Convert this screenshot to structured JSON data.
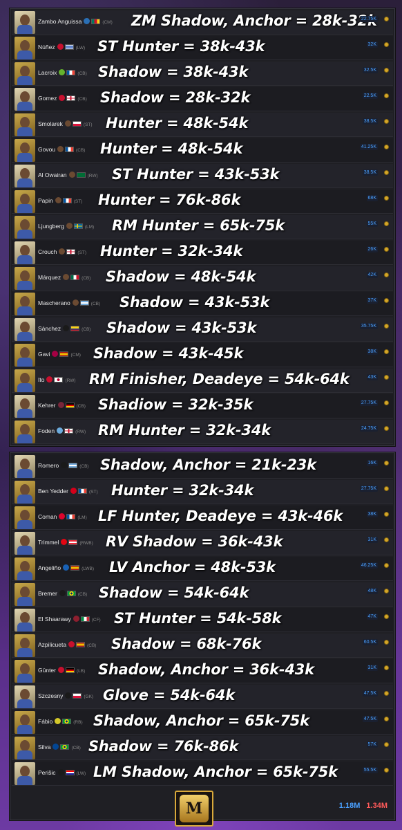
{
  "panel1": [
    {
      "name": "Zambo Anguissa",
      "pos": "(CM)",
      "price": "22.75K",
      "note": "ZM Shadow, Anchor = 28k-32k",
      "club_color": "#2a6fb5",
      "flag": "cameroon"
    },
    {
      "name": "Núñez",
      "pos": "(LW)",
      "price": "32K",
      "note": "ST Hunter = 38k-43k",
      "club_color": "#c8102e",
      "flag": "uruguay"
    },
    {
      "name": "Lacroix",
      "pos": "(CB)",
      "price": "32.5K",
      "note": "Shadow = 38k-43k",
      "club_color": "#65b32e",
      "flag": "france"
    },
    {
      "name": "Gomez",
      "pos": "(CB)",
      "price": "22.5K",
      "note": "Shadow = 28k-32k",
      "club_color": "#c8102e",
      "flag": "england"
    },
    {
      "name": "Smolarek",
      "pos": "(ST)",
      "price": "38.5K",
      "note": "Hunter = 48k-54k",
      "club_color": "#6b4a32",
      "flag": "poland"
    },
    {
      "name": "Govou",
      "pos": "(CB)",
      "price": "41.25K",
      "note": "Hunter = 48k-54k",
      "club_color": "#6b4a32",
      "flag": "france"
    },
    {
      "name": "Al Owairan",
      "pos": "(RW)",
      "price": "38.5K",
      "note": "ST Hunter = 43k-53k",
      "club_color": "#6b4a32",
      "flag": "saudi"
    },
    {
      "name": "Papin",
      "pos": "(ST)",
      "price": "68K",
      "note": "Hunter = 76k-86k",
      "club_color": "#6b4a32",
      "flag": "france"
    },
    {
      "name": "Ljungberg",
      "pos": "(LM)",
      "price": "55K",
      "note": "RM Hunter = 65k-75k",
      "club_color": "#6b4a32",
      "flag": "sweden"
    },
    {
      "name": "Crouch",
      "pos": "(ST)",
      "price": "26K",
      "note": "Hunter = 32k-34k",
      "club_color": "#6b4a32",
      "flag": "england"
    },
    {
      "name": "Márquez",
      "pos": "(CB)",
      "price": "42K",
      "note": "Shadow = 48k-54k",
      "club_color": "#6b4a32",
      "flag": "mexico"
    },
    {
      "name": "Mascherano",
      "pos": "(CB)",
      "price": "37K",
      "note": "Shadow = 43k-53k",
      "club_color": "#6b4a32",
      "flag": "argentina"
    },
    {
      "name": "Sánchez",
      "pos": "(CB)",
      "price": "35.75K",
      "note": "Shadow = 43k-53k",
      "club_color": "#1a1a1a",
      "flag": "colombia"
    },
    {
      "name": "Gavi",
      "pos": "(CM)",
      "price": "38K",
      "note": "Shadow = 43k-45k",
      "club_color": "#a50044",
      "flag": "spain"
    },
    {
      "name": "Ito",
      "pos": "(RW)",
      "price": "43K",
      "note": "RM Finisher, Deadeye = 54k-64k",
      "club_color": "#c8102e",
      "flag": "japan"
    },
    {
      "name": "Kehrer",
      "pos": "(CB)",
      "price": "27.75K",
      "note": "Shadiow = 32k-35k",
      "club_color": "#7a263a",
      "flag": "germany"
    },
    {
      "name": "Foden",
      "pos": "(RW)",
      "price": "24.75K",
      "note": "RM Hunter = 32k-34k",
      "club_color": "#6cabdd",
      "flag": "england"
    }
  ],
  "panel2": [
    {
      "name": "Romero",
      "pos": "(CB)",
      "price": "16K",
      "note": "Shadow, Anchor = 21k-23k",
      "club_color": "#1a1a1a",
      "flag": "argentina"
    },
    {
      "name": "Ben Yedder",
      "pos": "(ST)",
      "price": "27.75K",
      "note": "Hunter = 32k-34k",
      "club_color": "#d4001a",
      "flag": "france"
    },
    {
      "name": "Coman",
      "pos": "(LM)",
      "price": "38K",
      "note": "LF Hunter, Deadeye = 43k-46k",
      "club_color": "#dc052d",
      "flag": "france"
    },
    {
      "name": "Trimmel",
      "pos": "(RWB)",
      "price": "31K",
      "note": "RV Shadow = 36k-43k",
      "club_color": "#e30613",
      "flag": "austria"
    },
    {
      "name": "Angeliño",
      "pos": "(LWB)",
      "price": "46.25K",
      "note": "LV Anchor = 48k-53k",
      "club_color": "#1961b5",
      "flag": "spain"
    },
    {
      "name": "Bremer",
      "pos": "(CB)",
      "price": "48K",
      "note": "Shadow = 54k-64k",
      "club_color": "#1a1a1a",
      "flag": "brazil"
    },
    {
      "name": "El Shaarawy",
      "pos": "(CF)",
      "price": "47K",
      "note": "ST Hunter = 54k-58k",
      "club_color": "#8e1f2f",
      "flag": "italy"
    },
    {
      "name": "Azpilicueta",
      "pos": "(CB)",
      "price": "60.5K",
      "note": "Shadow = 68k-76k",
      "club_color": "#c8102e",
      "flag": "spain"
    },
    {
      "name": "Günter",
      "pos": "(LB)",
      "price": "31K",
      "note": "Shadow, Anchor = 36k-43k",
      "club_color": "#c8102e",
      "flag": "germany"
    },
    {
      "name": "Szczesny",
      "pos": "(GK)",
      "price": "47.5K",
      "note": "Glove = 54k-64k",
      "club_color": "#1a1a1a",
      "flag": "poland"
    },
    {
      "name": "Fábio",
      "pos": "(RB)",
      "price": "47.5K",
      "note": "Shadow, Anchor = 65k-75k",
      "club_color": "#d4c82a",
      "flag": "brazil"
    },
    {
      "name": "Silva",
      "pos": "(CB)",
      "price": "57K",
      "note": "Shadow = 76k-86k",
      "club_color": "#034694",
      "flag": "brazil"
    },
    {
      "name": "Perišic",
      "pos": "(LW)",
      "price": "55.5K",
      "note": "LM Shadow, Anchor = 65k-75k",
      "club_color": "#1a1a1a",
      "flag": "croatia"
    }
  ],
  "totals": {
    "blue": "1.18M",
    "red": "1.34M"
  },
  "logo_text": "M"
}
